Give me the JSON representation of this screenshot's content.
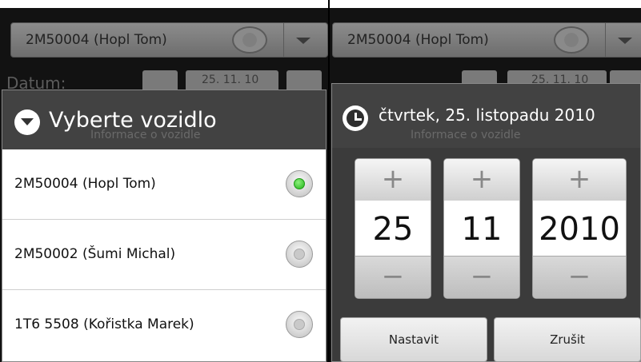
{
  "left": {
    "background": {
      "vehicle_value": "2M50004 (Hopl Tom)",
      "date_label": "Datum:",
      "date_value": "25. 11. 10"
    },
    "dialog": {
      "title": "Vyberte vozidlo",
      "ghost_text": "Informace o vozidle",
      "options": [
        {
          "label": "2M50004 (Hopl Tom)",
          "selected": true
        },
        {
          "label": "2M50002 (Šumi Michal)",
          "selected": false
        },
        {
          "label": "1T6 5508 (Kořistka Marek)",
          "selected": false
        }
      ]
    }
  },
  "right": {
    "background": {
      "vehicle_value": "2M50004 (Hopl Tom)",
      "date_value": "25. 11. 10"
    },
    "dialog": {
      "title": "čtvrtek, 25. listopadu 2010",
      "ghost_text": "Informace o vozidle",
      "day": "25",
      "month": "11",
      "year": "2010",
      "plus": "+",
      "minus": "−",
      "set_label": "Nastavit",
      "cancel_label": "Zrušit"
    }
  },
  "colors": {
    "selected_radio": "#22b418",
    "dialog_title_bg": "#424242"
  }
}
